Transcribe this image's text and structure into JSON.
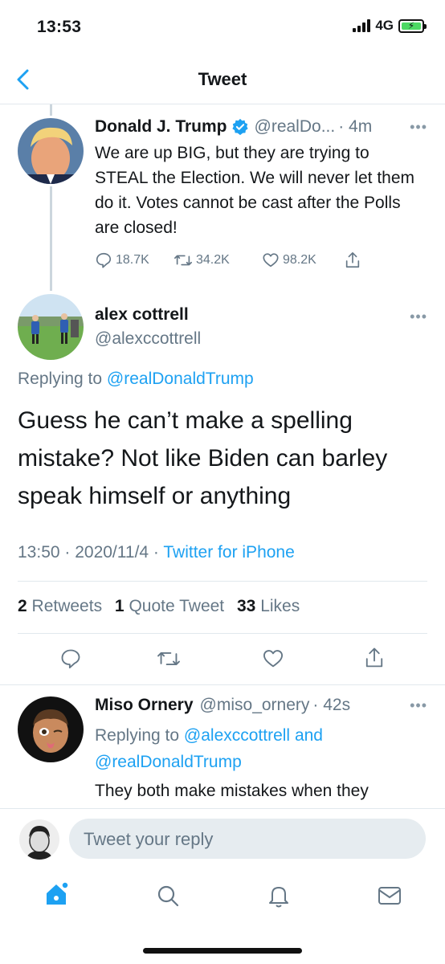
{
  "status_bar": {
    "time": "13:53",
    "network": "4G"
  },
  "nav": {
    "title": "Tweet",
    "back_icon": "chevron-left-icon"
  },
  "parent_tweet": {
    "name": "Donald J. Trump",
    "verified": true,
    "handle": "@realDo...",
    "time": "· 4m",
    "text": "We are up BIG, but they are trying to STEAL the Election. We will never let them do it. Votes cannot be cast after the Polls are closed!",
    "replies": "18.7K",
    "retweets": "34.2K",
    "likes": "98.2K"
  },
  "main_tweet": {
    "name": "alex cottrell",
    "handle": "@alexccottrell",
    "replying_prefix": "Replying to",
    "replying_to": "@realDonaldTrump",
    "text": "Guess he can’t make a spelling mistake? Not like Biden can barley speak himself or anything",
    "timestamp": "13:50 · 2020/11/4 ·",
    "source": "Twitter for iPhone",
    "stats": {
      "retweets_count": "2",
      "retweets_label": "Retweets",
      "quote_count": "1",
      "quote_label": "Quote Tweet",
      "likes_count": "33",
      "likes_label": "Likes"
    }
  },
  "reply_tweet": {
    "name": "Miso Ornery",
    "handle": "@miso_ornery",
    "time": "· 42s",
    "replying_prefix": "Replying to",
    "replying_to_1": "@alexccottrell",
    "replying_and": "and",
    "replying_to_2": "@realDonaldTrump",
    "text": "They both make mistakes when they"
  },
  "reply_bar": {
    "placeholder": "Tweet your reply"
  },
  "colors": {
    "accent": "#1da1f2",
    "text": "#14171a",
    "secondary": "#657786",
    "divider": "#e1e8ed"
  }
}
